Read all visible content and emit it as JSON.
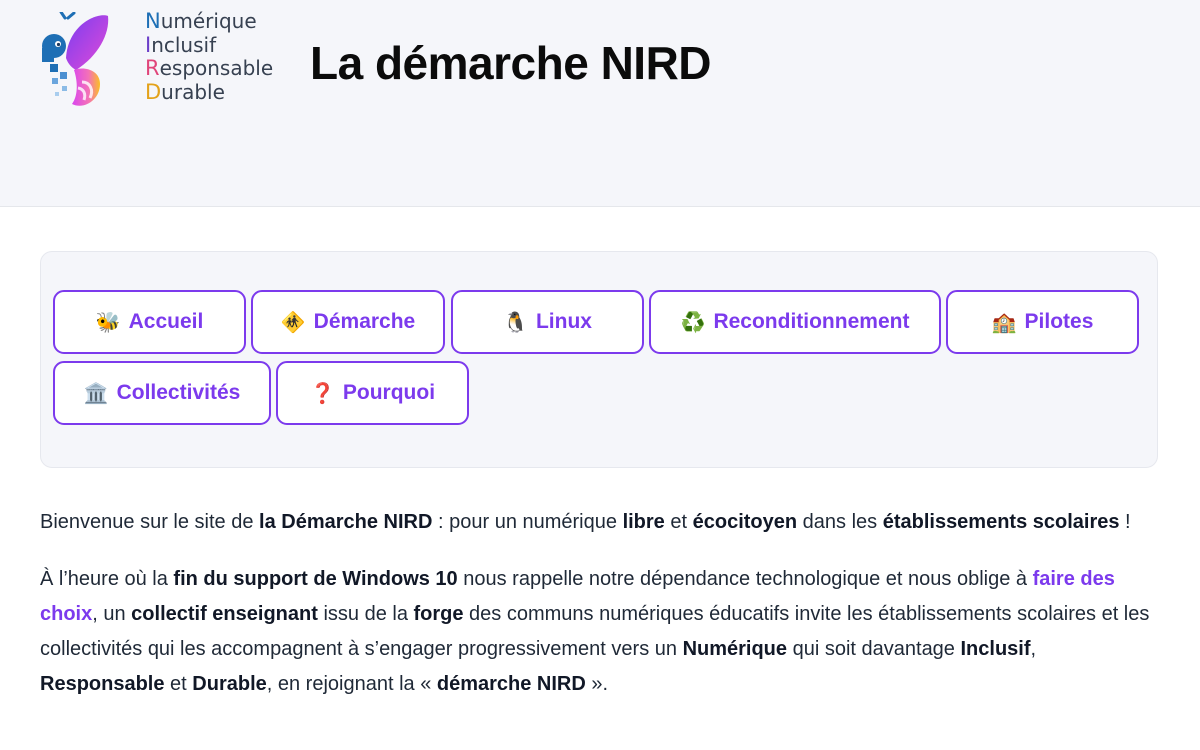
{
  "header": {
    "logo_words": [
      {
        "initial": "N",
        "rest": "umérique",
        "color": "#1e6fb5"
      },
      {
        "initial": "I",
        "rest": "nclusif",
        "color": "#6b3fc9"
      },
      {
        "initial": "R",
        "rest": "esponsable",
        "color": "#e0457a"
      },
      {
        "initial": "D",
        "rest": "urable",
        "color": "#e3a21a"
      }
    ],
    "title": "La démarche NIRD"
  },
  "nav": {
    "items": [
      {
        "icon": "🐝",
        "icon_name": "bee-icon",
        "label": "Accueil"
      },
      {
        "icon": "🚸",
        "icon_name": "children-crossing-icon",
        "label": "Démarche"
      },
      {
        "icon": "🐧",
        "icon_name": "penguin-icon",
        "label": "Linux"
      },
      {
        "icon": "♻️",
        "icon_name": "recycle-icon",
        "label": "Reconditionnement"
      },
      {
        "icon": "🏫",
        "icon_name": "school-icon",
        "label": "Pilotes"
      },
      {
        "icon": "🏛️",
        "icon_name": "classical-building-icon",
        "label": "Collectivités"
      },
      {
        "icon": "❓",
        "icon_name": "question-mark-icon",
        "label": "Pourquoi"
      }
    ],
    "accent_color": "#7c3aed"
  },
  "content": {
    "p1": {
      "t1": "Bienvenue sur le site de ",
      "b1": "la Démarche NIRD",
      "t2": " : pour un numérique ",
      "b2": "libre",
      "t3": " et ",
      "b3": "écocitoyen",
      "t4": " dans les ",
      "b4": "établissements scolaires",
      "t5": " !"
    },
    "p2": {
      "t1": "À l’heure où la ",
      "b1": "fin du support de Windows 10",
      "t2": " nous rappelle notre dépendance technologique et nous oblige à ",
      "link1": "faire des choix",
      "t3": ", un ",
      "b2": "collectif enseignant",
      "t4": " issu de la ",
      "b3": "forge",
      "t5": " des communs numériques éducatifs invite les établissements scolaires et les collectivités qui les accompagnent à s’engager progressivement vers un ",
      "b4": "Numérique",
      "t6": " qui soit davantage ",
      "b5": "Inclusif",
      "t7": ", ",
      "b6": "Responsable",
      "t8": " et ",
      "b7": "Durable",
      "t9": ", en rejoignant la « ",
      "b8": "démarche NIRD",
      "t10": " »."
    }
  }
}
